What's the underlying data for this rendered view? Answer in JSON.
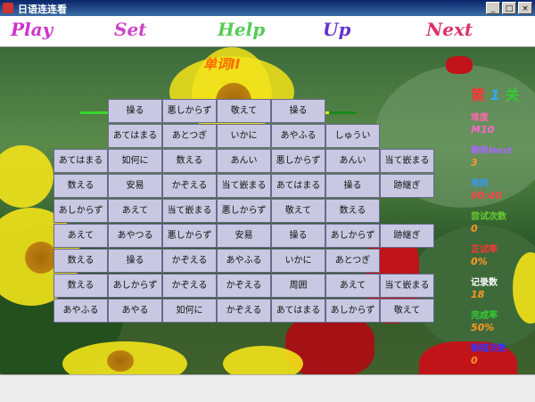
{
  "window": {
    "title": "日语连连看"
  },
  "toolbar": {
    "items": [
      {
        "label": "Play",
        "color": "#cc33cc"
      },
      {
        "label": "Set",
        "color": "#cc44cc"
      },
      {
        "label": "Help",
        "color": "#55cc55"
      },
      {
        "label": "Up",
        "color": "#6633cc"
      },
      {
        "label": "Next",
        "color": "#dd3366"
      }
    ]
  },
  "game": {
    "word_title": "单词II",
    "progress_fraction": 0.9,
    "board": [
      [
        "",
        "",
        "",
        "",
        "",
        "",
        "",
        ""
      ],
      [
        "",
        "操る",
        "悪しからず",
        "敬えて",
        "操る",
        "",
        "",
        ""
      ],
      [
        "",
        "あてはまる",
        "あとつぎ",
        "いかに",
        "あやふる",
        "しゅうい",
        "",
        ""
      ],
      [
        "あてはまる",
        "如何に",
        "数える",
        "あんい",
        "悪しからず",
        "あんい",
        "当て嵌まる",
        ""
      ],
      [
        "数える",
        "安易",
        "かぞえる",
        "当て嵌まる",
        "あてはまる",
        "操る",
        "跡継ぎ",
        ""
      ],
      [
        "あしからず",
        "あえて",
        "当て嵌まる",
        "悪しからず",
        "敬えて",
        "数える",
        "",
        ""
      ],
      [
        "あえて",
        "あやつる",
        "悪しからず",
        "安易",
        "操る",
        "あしからず",
        "跡継ぎ",
        ""
      ],
      [
        "数える",
        "操る",
        "かぞえる",
        "あやふる",
        "いかに",
        "あとつぎ",
        "",
        ""
      ],
      [
        "数える",
        "あしからず",
        "かぞえる",
        "かぞえる",
        "周囲",
        "あえて",
        "当て嵌まる",
        ""
      ],
      [
        "あやふる",
        "あやる",
        "如何に",
        "かぞえる",
        "あてはまる",
        "あしからず",
        "敬えて",
        ""
      ]
    ]
  },
  "side_panel": {
    "level": {
      "prefix": "第",
      "number": "1",
      "suffix": "关"
    },
    "stats": [
      {
        "label": "难度",
        "value": "M10",
        "label_color": "#ff66aa",
        "value_color": "#ff66cc"
      },
      {
        "label": "剩有Next",
        "value": "3",
        "label_color": "#aa66ff",
        "value_color": "#ff9922"
      },
      {
        "label": "用时",
        "value": "00:40",
        "label_color": "#3399ff",
        "value_color": "#ff4444"
      },
      {
        "label": "尝试次数",
        "value": "0",
        "label_color": "#66cc33",
        "value_color": "#ff9922"
      },
      {
        "label": "正试率",
        "value": "0%",
        "label_color": "#ff3333",
        "value_color": "#ff9922"
      },
      {
        "label": "记录数",
        "value": "18",
        "label_color": "#ffffff",
        "value_color": "#ff9922"
      },
      {
        "label": "完成率",
        "value": "50%",
        "label_color": "#33cc33",
        "value_color": "#ff9922"
      },
      {
        "label": "剩错次数",
        "value": "0",
        "label_color": "#3333ff",
        "value_color": "#ff9922"
      }
    ]
  }
}
